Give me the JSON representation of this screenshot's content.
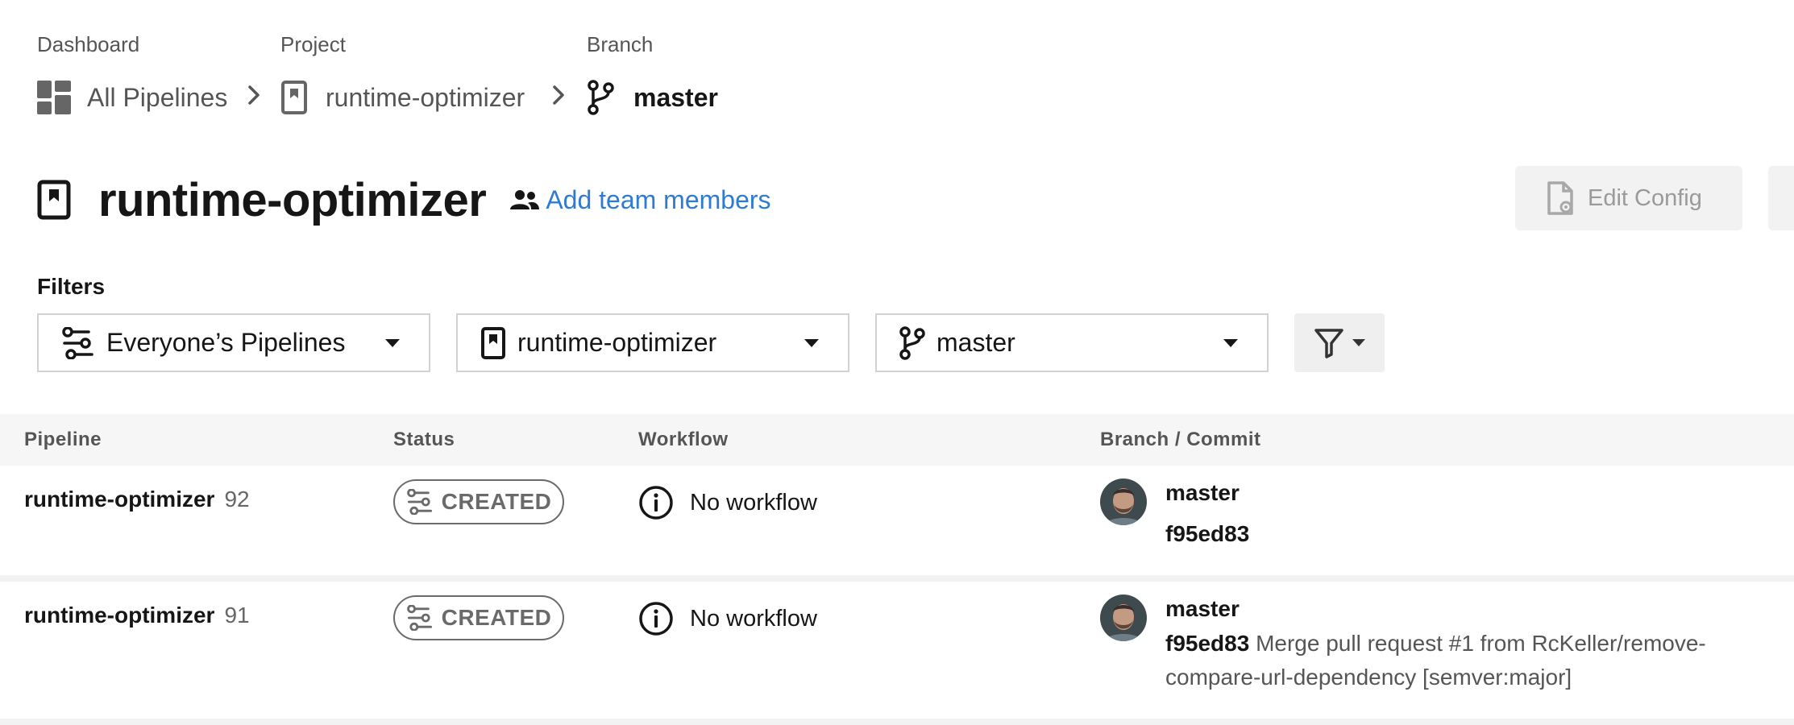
{
  "breadcrumb": {
    "dashboard": {
      "label": "Dashboard",
      "value": "All Pipelines"
    },
    "project": {
      "label": "Project",
      "value": "runtime-optimizer"
    },
    "branch": {
      "label": "Branch",
      "value": "master"
    }
  },
  "header": {
    "title": "runtime-optimizer",
    "add_team_label": "Add team members",
    "edit_config_label": "Edit Config"
  },
  "filters": {
    "label": "Filters",
    "pipelines_select": "Everyone’s Pipelines",
    "project_select": "runtime-optimizer",
    "branch_select": "master"
  },
  "table": {
    "columns": [
      "Pipeline",
      "Status",
      "Workflow",
      "Branch / Commit"
    ],
    "rows": [
      {
        "pipeline": "runtime-optimizer",
        "number": "92",
        "status": "CREATED",
        "workflow": "No workflow",
        "branch": "master",
        "commit_sha": "f95ed83",
        "commit_message": ""
      },
      {
        "pipeline": "runtime-optimizer",
        "number": "91",
        "status": "CREATED",
        "workflow": "No workflow",
        "branch": "master",
        "commit_sha": "f95ed83",
        "commit_message": "Merge pull request #1 from RcKeller/remove-compare-url-dependency [semver:major]"
      }
    ]
  },
  "colors": {
    "link": "#2f7bd1",
    "status_created": "#6a6a6a",
    "header_bg": "#f6f6f6"
  }
}
